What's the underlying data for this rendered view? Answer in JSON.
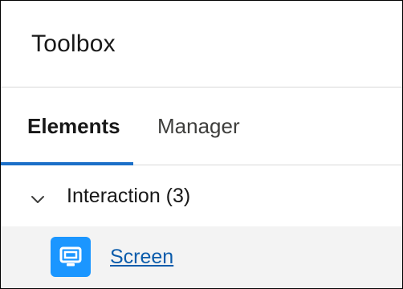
{
  "toolbox": {
    "title": "Toolbox",
    "tabs": [
      {
        "label": "Elements",
        "active": true
      },
      {
        "label": "Manager",
        "active": false
      }
    ],
    "sections": [
      {
        "label": "Interaction (3)",
        "expanded": true,
        "items": [
          {
            "label": "Screen",
            "icon": "screen-icon",
            "icon_color": "#1b96ff"
          }
        ]
      }
    ]
  },
  "colors": {
    "accent": "#1b6fc8",
    "link": "#0b5cab",
    "icon_bg": "#1b96ff",
    "row_highlight": "#f3f3f3"
  }
}
